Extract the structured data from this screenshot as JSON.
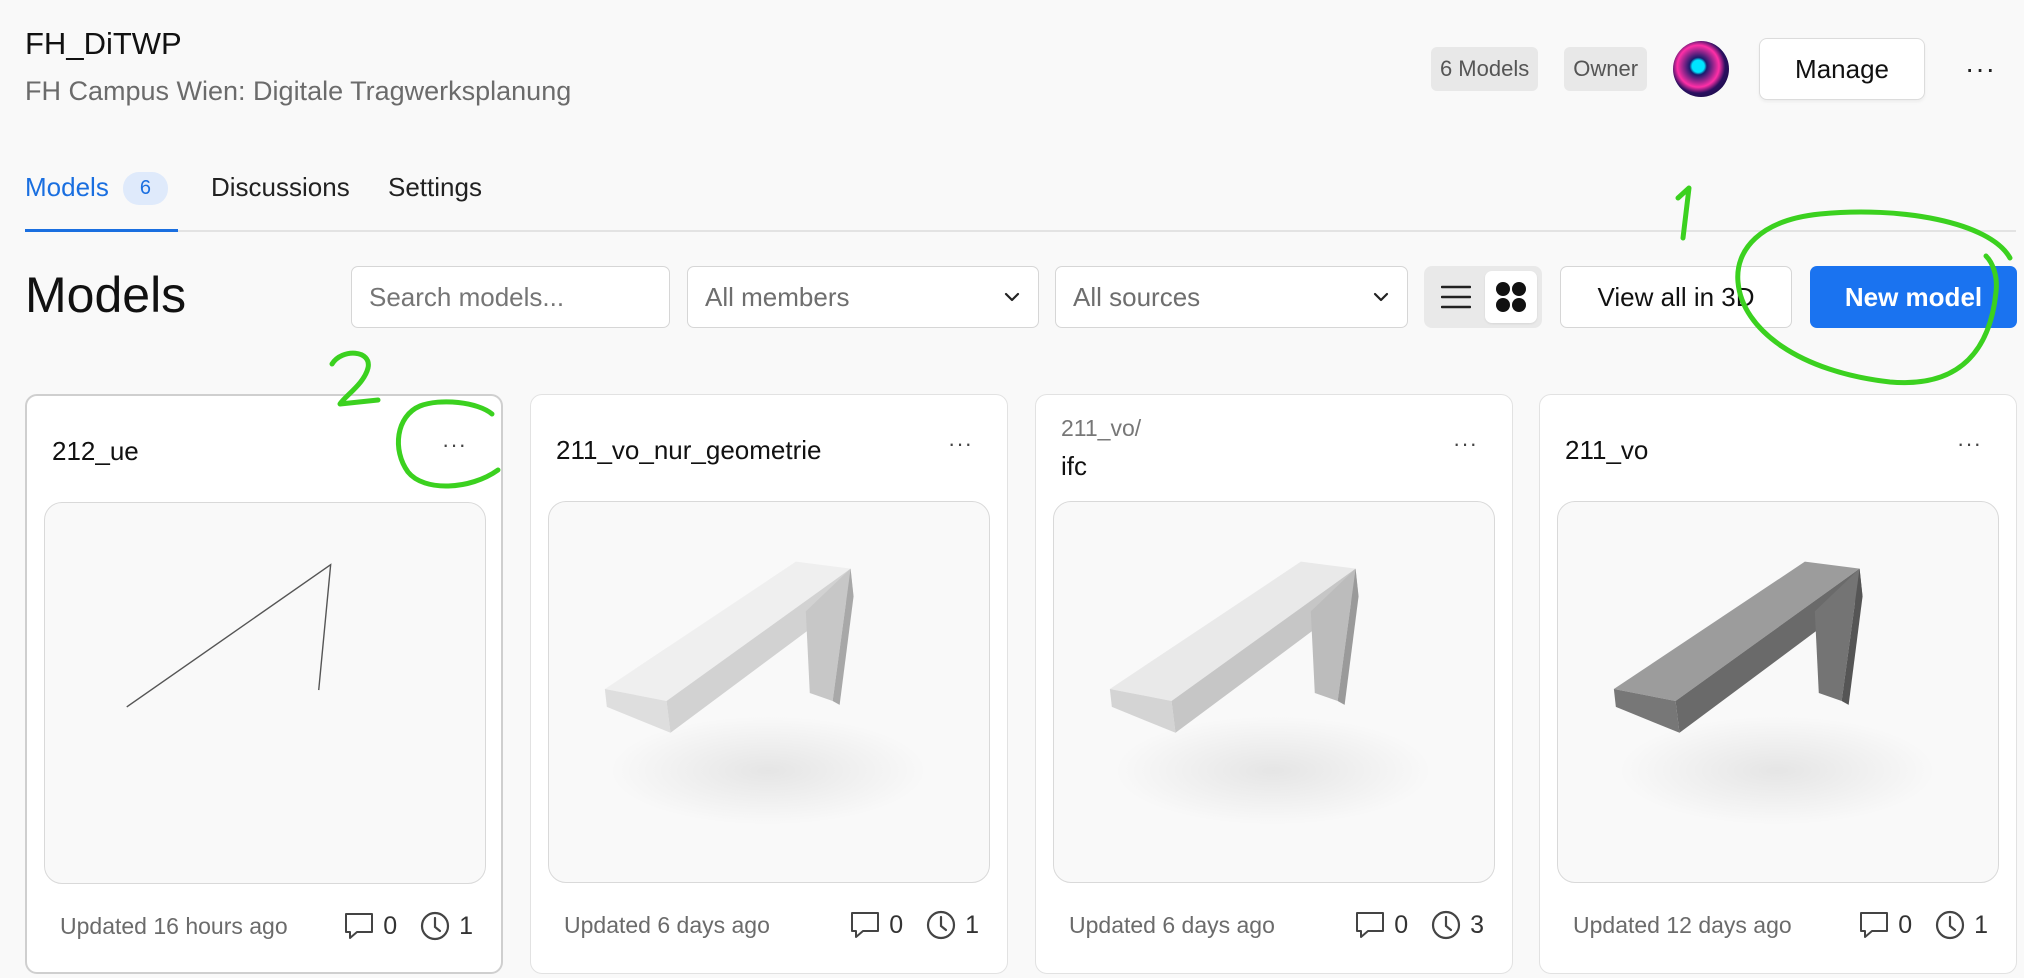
{
  "header": {
    "title": "FH_DiTWP",
    "subtitle": "FH Campus Wien: Digitale Tragwerksplanung",
    "models_badge": "6 Models",
    "role_badge": "Owner",
    "manage_label": "Manage",
    "more_label": "···"
  },
  "tabs": [
    {
      "label": "Models",
      "count": "6"
    },
    {
      "label": "Discussions"
    },
    {
      "label": "Settings"
    }
  ],
  "section_title": "Models",
  "filters": {
    "search_placeholder": "Search models...",
    "members": "All members",
    "sources": "All sources"
  },
  "actions": {
    "view_all_3d": "View all in 3D",
    "new_model": "New model"
  },
  "cards": [
    {
      "prefix": "",
      "title": "212_ue",
      "updated": "Updated 16 hours ago",
      "comments": "0",
      "versions": "1",
      "preview": "lines"
    },
    {
      "prefix": "",
      "title": "211_vo_nur_geometrie",
      "updated": "Updated 6 days ago",
      "comments": "0",
      "versions": "1",
      "preview": "light"
    },
    {
      "prefix": "211_vo/",
      "title": "ifc",
      "updated": "Updated 6 days ago",
      "comments": "0",
      "versions": "3",
      "preview": "light"
    },
    {
      "prefix": "",
      "title": "211_vo",
      "updated": "Updated 12 days ago",
      "comments": "0",
      "versions": "1",
      "preview": "dark"
    }
  ],
  "card_more_label": "···",
  "annotations": [
    "1",
    "2"
  ],
  "colors": {
    "accent": "#1a73f0",
    "annotation": "#3bd11f"
  }
}
